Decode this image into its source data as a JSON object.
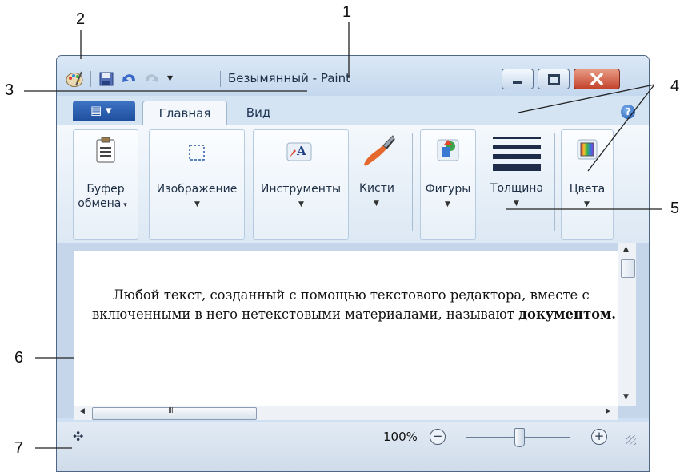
{
  "callouts": [
    "1",
    "2",
    "3",
    "4",
    "5",
    "6",
    "7"
  ],
  "window": {
    "title": "Безымянный - Paint",
    "qat_more": "▾"
  },
  "tabs": {
    "file": "▤ ▾",
    "home": "Главная",
    "view": "Вид",
    "help": "?"
  },
  "ribbon": {
    "clipboard": [
      "Буфер",
      "обмена"
    ],
    "image": "Изображение",
    "tools": "Инструменты",
    "brushes": "Кисти",
    "shapes": "Фигуры",
    "size": "Толщина",
    "colors": "Цвета"
  },
  "document": {
    "text_before": "Любой текст, созданный с помощью текстового редактора, вместе с включенными в него нетекстовыми материалами, называют ",
    "text_bold": "документом."
  },
  "scroll": {
    "up": "▲",
    "down": "▼",
    "left": "◀",
    "right": "▶",
    "grip_h": "III"
  },
  "status": {
    "move_icon_glyph": "✣",
    "zoom": "100%",
    "zoom_level": 0.5,
    "zoom_out": "−",
    "zoom_in": "+"
  },
  "colors": {
    "title_bg": "#c4d8ee",
    "file_tab": "#1d4f9d",
    "close": "#c4442d"
  },
  "icons": {
    "app": "paint-palette-icon",
    "save": "save-icon",
    "undo": "undo-icon",
    "redo": "redo-icon",
    "minimize": "minimize-icon",
    "maximize": "maximize-icon",
    "close": "close-icon",
    "help": "help-icon"
  }
}
